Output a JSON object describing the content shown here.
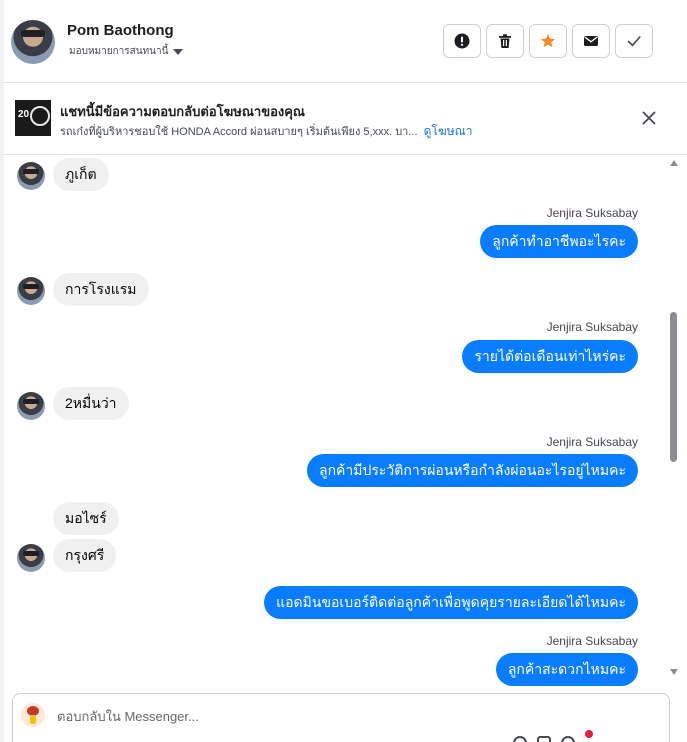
{
  "contact": {
    "name": "Pom Baothong",
    "assignee_label": "มอบหมายการสนทนานี้"
  },
  "header_actions": [
    {
      "name": "report-button",
      "icon": "exclamation-icon"
    },
    {
      "name": "delete-button",
      "icon": "trash-icon"
    },
    {
      "name": "star-button",
      "icon": "star-icon",
      "color": "#f28c28"
    },
    {
      "name": "mark-unread-button",
      "icon": "envelope-icon"
    },
    {
      "name": "mark-done-button",
      "icon": "checkmark-icon"
    }
  ],
  "ad_banner": {
    "title": "แชทนี้มีข้อความตอบกลับต่อโฆษณาของคุณ",
    "snippet": "รถเก๋งที่ผู้บริหารชอบใช้ HONDA Accord ผ่อนสบายๆ เริ่มต้นเพียง 5,xxx. บา...",
    "link_label": "ดูโฆษณา"
  },
  "messages": [
    {
      "direction": "in",
      "text": "ภูเก็ต"
    },
    {
      "direction": "out",
      "sender": "Jenjira Suksabay",
      "text": "ลูกค้าทำอาชีพอะไรคะ"
    },
    {
      "direction": "in",
      "text": "การโรงแรม"
    },
    {
      "direction": "out",
      "sender": "Jenjira Suksabay",
      "text": "รายได้ต่อเดือนเท่าไหร่คะ"
    },
    {
      "direction": "in",
      "text": "2หมื่นว่า"
    },
    {
      "direction": "out",
      "sender": "Jenjira Suksabay",
      "text": "ลูกค้ามีประวัติการผ่อนหรือกำลังผ่อนอะไรอยู่ไหมคะ"
    },
    {
      "direction": "in",
      "text": "มอไซร์"
    },
    {
      "direction": "in",
      "text": "กรุงศรี"
    },
    {
      "direction": "out",
      "text": "แอดมินขอเบอร์ติดต่อลูกค้าเพื่อพูดคุยรายละเอียดได้ไหมคะ"
    },
    {
      "direction": "out",
      "sender": "Jenjira Suksabay",
      "text": "ลูกค้าสะดวกไหมคะ"
    }
  ],
  "composer": {
    "placeholder": "ตอบกลับใน Messenger..."
  },
  "colors": {
    "outgoing_bubble": "#0a7cff",
    "incoming_bubble": "#f0f0f0",
    "link": "#1b74e4"
  }
}
